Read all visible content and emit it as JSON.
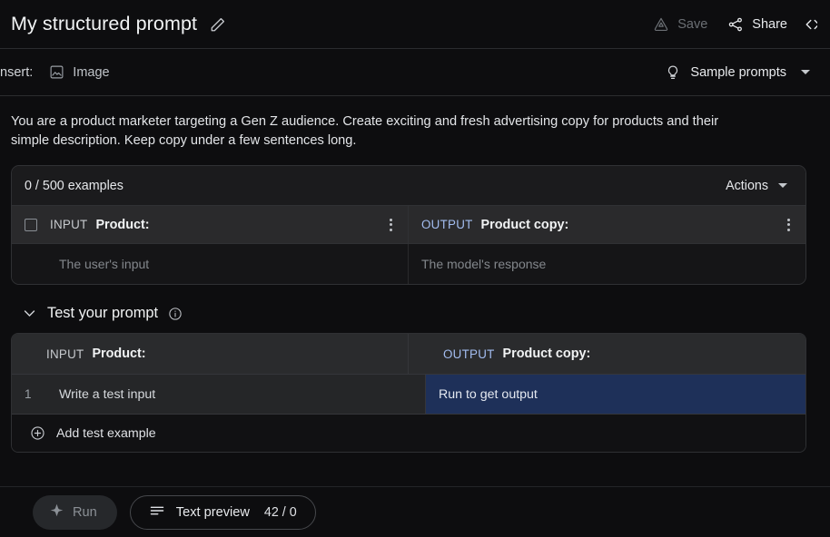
{
  "header": {
    "doc_title": "My structured prompt",
    "edit_icon": "pencil-icon",
    "save_label": "Save",
    "save_icon": "cloud-save-icon",
    "share_label": "Share",
    "share_icon": "share-nodes-icon",
    "code_icon": "code-brackets-icon"
  },
  "insert_bar": {
    "insert_label": "Insert:",
    "image_label": "Image",
    "image_icon": "image-icon",
    "sample_prompts_label": "Sample prompts",
    "bulb_icon": "lightbulb-icon",
    "caret_icon": "chevron-down-icon"
  },
  "prompt": {
    "text": "You are a product marketer targeting a Gen Z audience. Create exciting and fresh advertising copy for products and their simple description. Keep copy under a few sentences long."
  },
  "examples": {
    "count_label": "0 / 500 examples",
    "actions_label": "Actions",
    "input_tag": "INPUT",
    "input_field": "Product:",
    "output_tag": "OUTPUT",
    "output_field": "Product copy:",
    "input_placeholder": "The user's input",
    "output_placeholder": "The model's response",
    "kebab_icon": "more-vertical-icon",
    "checkbox_icon": "checkbox-unchecked-icon"
  },
  "test": {
    "section_title": "Test your prompt",
    "collapse_icon": "chevron-down-icon",
    "info_icon": "info-circle-icon",
    "input_tag": "INPUT",
    "input_field": "Product:",
    "output_tag": "OUTPUT",
    "output_field": "Product copy:",
    "rows": [
      {
        "number": "1",
        "input_placeholder": "Write a test input",
        "output_placeholder": "Run to get output",
        "output_selected": true
      }
    ],
    "add_label": "Add test example",
    "add_icon": "plus-circle-icon"
  },
  "bottom": {
    "run_label": "Run",
    "run_icon": "sparkle-icon",
    "preview_label": "Text preview",
    "preview_icon": "list-lines-icon",
    "preview_count": "42 / 0"
  },
  "colors": {
    "page_bg": "#0d0d0f",
    "output_tag": "#a3bdf0",
    "selected_cell_bg": "#1e3059",
    "card_header_bg": "#2a2a2c",
    "disabled_text": "#6b6f74"
  }
}
